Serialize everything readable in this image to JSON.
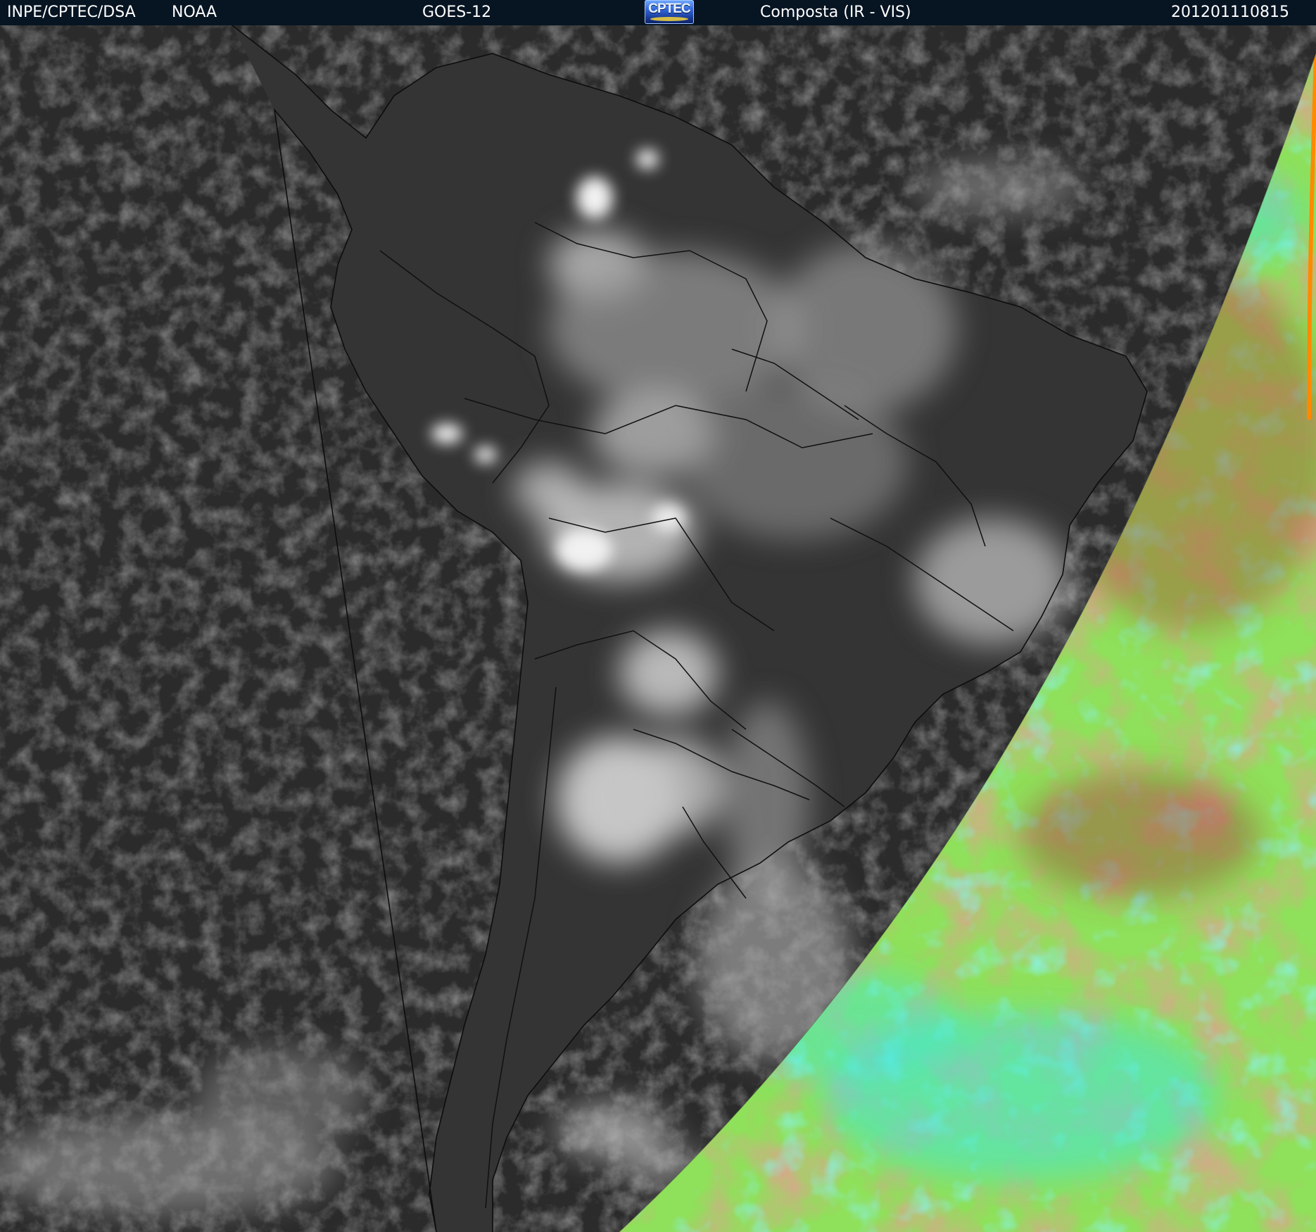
{
  "header": {
    "org": "INPE/CPTEC/DSA",
    "agency": "NOAA",
    "satellite": "GOES-12",
    "logo_text": "CPTEC",
    "product": "Composta (IR - VIS)",
    "timestamp": "201201110815"
  },
  "colors": {
    "header_bg": "#071422",
    "ocean_ir": "#2a2a2a",
    "land_ir": "#3a3a3a",
    "cloud": "#d8d8d8",
    "day_side_green": "#8fe05a",
    "day_side_cyan": "#40e8d8",
    "day_side_brown": "#a06a3c",
    "border_lines": "#111111",
    "limb_edge": "#ff8a00"
  }
}
